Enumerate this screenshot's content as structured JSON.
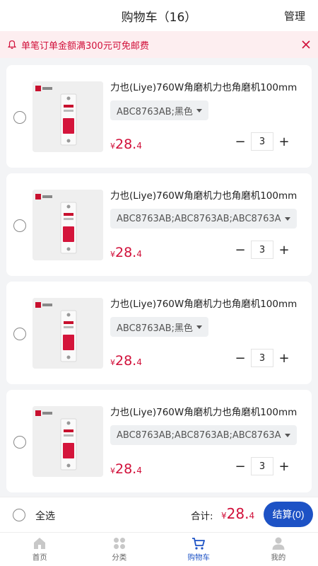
{
  "header": {
    "title": "购物车（16）",
    "manage": "管理"
  },
  "notice": {
    "text": "单笔订单金额满300元可免邮费"
  },
  "items": [
    {
      "name": "力也(Liye)760W角磨机力也角磨机100mm",
      "spec": "ABC8763AB;黑色",
      "price_currency": "¥",
      "price_int": "28.",
      "price_dec": "4",
      "qty": "3"
    },
    {
      "name": "力也(Liye)760W角磨机力也角磨机100mm",
      "spec": "ABC8763AB;ABC8763AB;ABC8763A",
      "price_currency": "¥",
      "price_int": "28.",
      "price_dec": "4",
      "qty": "3"
    },
    {
      "name": "力也(Liye)760W角磨机力也角磨机100mm",
      "spec": "ABC8763AB;黑色",
      "price_currency": "¥",
      "price_int": "28.",
      "price_dec": "4",
      "qty": "3"
    },
    {
      "name": "力也(Liye)760W角磨机力也角磨机100mm",
      "spec": "ABC8763AB;ABC8763AB;ABC8763A",
      "price_currency": "¥",
      "price_int": "28.",
      "price_dec": "4",
      "qty": "3"
    }
  ],
  "checkout": {
    "select_all": "全选",
    "total_label": "合计:",
    "total_currency": "¥",
    "total_int": "28.",
    "total_dec": "4",
    "submit": "结算(0)"
  },
  "tabs": [
    {
      "label": "首页",
      "icon": "home-icon"
    },
    {
      "label": "分类",
      "icon": "category-icon"
    },
    {
      "label": "购物车",
      "icon": "cart-icon",
      "active": true
    },
    {
      "label": "我的",
      "icon": "user-icon"
    }
  ],
  "colors": {
    "accent": "#1d52c5",
    "price": "#d1103a",
    "notice_bg": "#fdeef0"
  }
}
